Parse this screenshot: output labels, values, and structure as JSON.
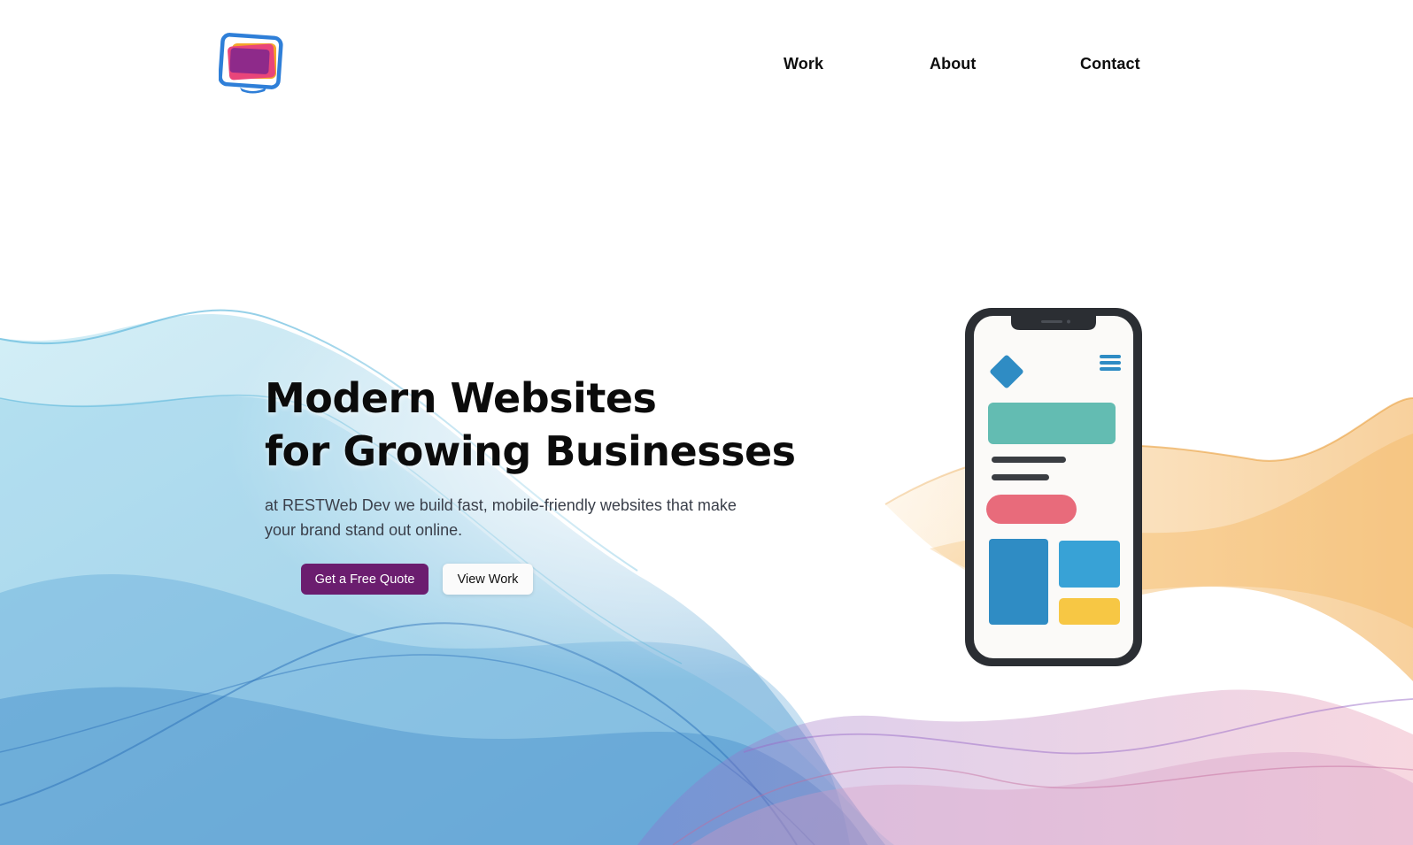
{
  "brand": {
    "logo_icon": "monitor-logo-icon",
    "colors": {
      "blue": "#2f7fd8",
      "magenta": "#8e2a8a",
      "pink": "#e9457a",
      "orange": "#f4a62a"
    }
  },
  "nav": {
    "items": [
      {
        "label": "Work"
      },
      {
        "label": "About"
      },
      {
        "label": "Contact"
      }
    ]
  },
  "hero": {
    "headline_line1": "Modern Websites",
    "headline_line2": "for Growing Businesses",
    "subtitle": "at RESTWeb Dev we build fast, mobile-friendly websites that make your brand stand out online.",
    "primary_button": "Get a Free Quote",
    "secondary_button": "View Work",
    "primary_color": "#6b1d6f"
  },
  "illustration": {
    "icon": "smartphone-mockup-icon",
    "colors": {
      "teal": "#63bcb2",
      "coral": "#e86b7b",
      "blue": "#2f8cc4",
      "light_blue": "#38a2d6",
      "yellow": "#f7c744",
      "frame": "#2b2e33"
    }
  }
}
